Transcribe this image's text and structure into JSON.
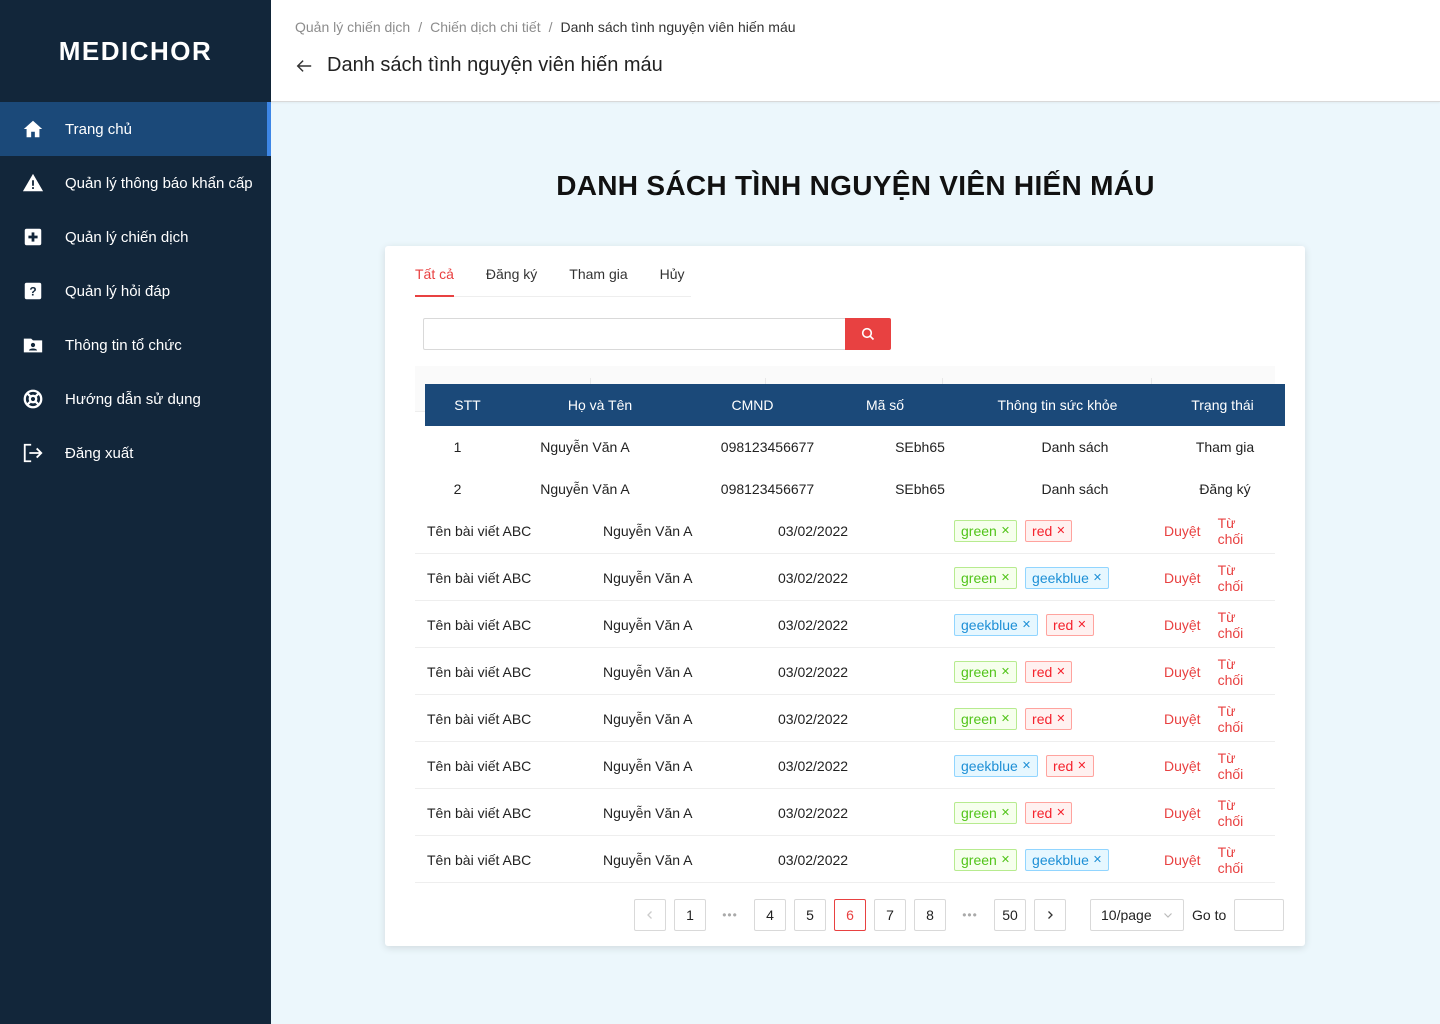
{
  "sidebar": {
    "logo": "MEDICHOR",
    "items": [
      {
        "label": "Trang chủ",
        "icon": "home-icon"
      },
      {
        "label": "Quản lý thông báo khẩn cấp",
        "icon": "warning-icon"
      },
      {
        "label": "Quản lý chiến dịch",
        "icon": "medical-plus-icon"
      },
      {
        "label": "Quản lý hỏi đáp",
        "icon": "question-icon"
      },
      {
        "label": "Thông tin tổ chức",
        "icon": "folder-user-icon"
      },
      {
        "label": "Hướng dẫn sử dụng",
        "icon": "lifebuoy-icon"
      },
      {
        "label": "Đăng xuất",
        "icon": "logout-icon"
      }
    ]
  },
  "header": {
    "breadcrumb": [
      "Quản lý chiến dịch",
      "Chiến dịch chi tiết",
      "Danh sách tình nguyện viên hiến máu"
    ],
    "title": "Danh sách tình nguyện viên hiến máu"
  },
  "main_title": "DANH SÁCH TÌNH NGUYỆN VIÊN HIẾN MÁU",
  "tabs": [
    "Tất cả",
    "Đăng ký",
    "Tham gia",
    "Hủy"
  ],
  "search": {
    "placeholder": "",
    "value": ""
  },
  "volunteer_table": {
    "columns": [
      "STT",
      "Họ và Tên",
      "CMND",
      "Mã số",
      "Thông tin sức khỏe",
      "Trạng thái"
    ],
    "rows": [
      [
        "1",
        "Nguyễn Văn A",
        "098123456677",
        "SEbh65",
        "Danh sách",
        "Tham gia"
      ],
      [
        "2",
        "Nguyễn Văn A",
        "098123456677",
        "SEbh65",
        "Danh sách",
        "Đăng ký"
      ]
    ]
  },
  "post_rows": [
    {
      "title": "Tên bài viết ABC",
      "author": "Nguyễn Văn A",
      "date": "03/02/2022",
      "tags": [
        "green",
        "red"
      ]
    },
    {
      "title": "Tên bài viết ABC",
      "author": "Nguyễn Văn A",
      "date": "03/02/2022",
      "tags": [
        "green",
        "geekblue"
      ]
    },
    {
      "title": "Tên bài viết ABC",
      "author": "Nguyễn Văn A",
      "date": "03/02/2022",
      "tags": [
        "geekblue",
        "red"
      ]
    },
    {
      "title": "Tên bài viết ABC",
      "author": "Nguyễn Văn A",
      "date": "03/02/2022",
      "tags": [
        "green",
        "red"
      ]
    },
    {
      "title": "Tên bài viết ABC",
      "author": "Nguyễn Văn A",
      "date": "03/02/2022",
      "tags": [
        "green",
        "red"
      ]
    },
    {
      "title": "Tên bài viết ABC",
      "author": "Nguyễn Văn A",
      "date": "03/02/2022",
      "tags": [
        "geekblue",
        "red"
      ]
    },
    {
      "title": "Tên bài viết ABC",
      "author": "Nguyễn Văn A",
      "date": "03/02/2022",
      "tags": [
        "green",
        "red"
      ]
    },
    {
      "title": "Tên bài viết ABC",
      "author": "Nguyễn Văn A",
      "date": "03/02/2022",
      "tags": [
        "green",
        "geekblue"
      ]
    }
  ],
  "actions": {
    "approve": "Duyệt",
    "reject": "Từ chối"
  },
  "pagination": {
    "pages": [
      "1",
      "4",
      "5",
      "6",
      "7",
      "8",
      "50"
    ],
    "current": "6",
    "page_size": "10/page",
    "goto_label": "Go to"
  },
  "colors": {
    "accent": "#e84141",
    "sidebar_bg": "#12263a",
    "active_nav": "#1b4979",
    "table_head": "#1b4979"
  }
}
